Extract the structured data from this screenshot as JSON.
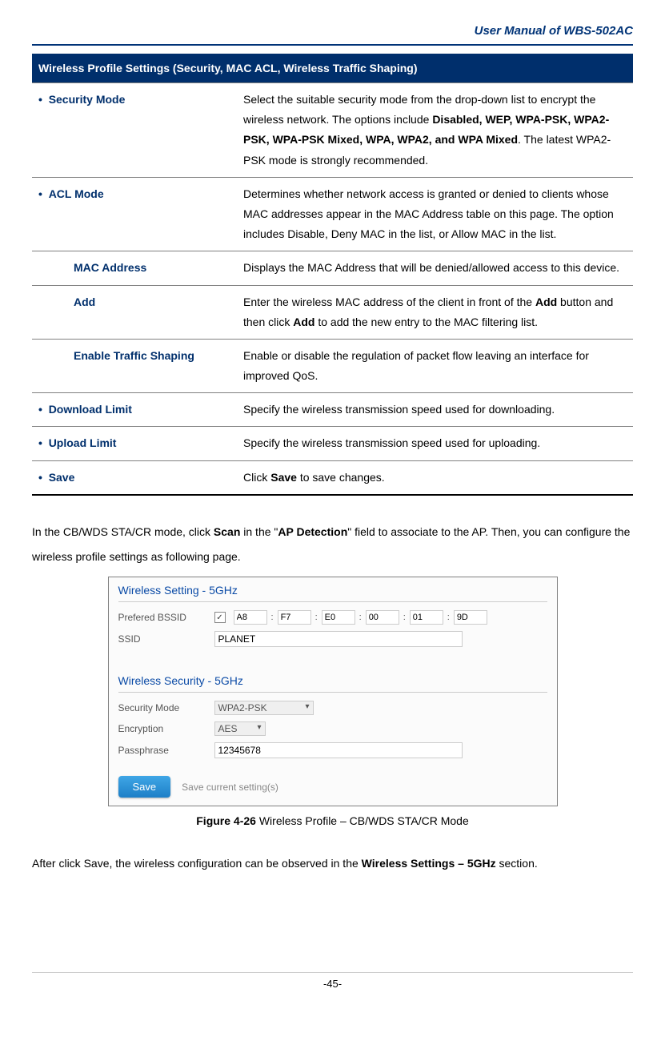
{
  "header": {
    "title": "User  Manual  of  WBS-502AC"
  },
  "table": {
    "heading": "Wireless Profile Settings (Security, MAC ACL, Wireless Traffic Shaping)",
    "rows": [
      {
        "bullet": true,
        "term": "Security Mode",
        "desc_html": "Select the suitable security mode from the drop-down list to encrypt the wireless network. The options include <b class='inner'>Disabled, WEP, WPA-PSK, WPA2-PSK, WPA-PSK Mixed, WPA, WPA2, and WPA Mixed</b>. The latest WPA2-PSK mode is strongly recommended."
      },
      {
        "bullet": true,
        "term": "ACL Mode",
        "desc_html": "Determines whether network access is granted or denied to clients whose MAC addresses appear in the MAC Address table on this page. The option includes Disable, Deny MAC in the list, or Allow MAC in the list."
      },
      {
        "bullet": false,
        "indent": true,
        "term": "MAC Address",
        "desc_html": "Displays the MAC Address that will be denied/allowed access to this device."
      },
      {
        "bullet": false,
        "indent": true,
        "term": "Add",
        "desc_html": "Enter the wireless MAC address of the client in front of the <b class='inner'>Add</b> button and then click <b class='inner'>Add</b> to add the new entry to the MAC filtering list."
      },
      {
        "bullet": false,
        "indent": true,
        "term": "Enable Traffic Shaping",
        "desc_html": "Enable or disable the regulation of packet flow leaving an interface for improved QoS."
      },
      {
        "bullet": true,
        "term": "Download Limit",
        "desc_html": "Specify the wireless transmission speed used for downloading."
      },
      {
        "bullet": true,
        "term": "Upload Limit",
        "desc_html": "Specify the wireless transmission speed used for uploading."
      },
      {
        "bullet": true,
        "term": "Save",
        "desc_html": "Click <b class='inner'>Save</b> to save changes."
      }
    ]
  },
  "para1_html": "In the CB/WDS STA/CR mode, click <b class='inner'>Scan</b> in the \"<b class='inner'>AP Detection</b>\" field to associate to the AP. Then, you can configure the wireless profile settings as following page.",
  "screenshot": {
    "section1_title": "Wireless Setting - 5GHz",
    "bssid": {
      "label": "Prefered BSSID",
      "checked": true,
      "values": [
        "A8",
        "F7",
        "E0",
        "00",
        "01",
        "9D"
      ]
    },
    "ssid": {
      "label": "SSID",
      "value": "PLANET"
    },
    "section2_title": "Wireless Security - 5GHz",
    "security": {
      "label": "Security Mode",
      "value": "WPA2-PSK"
    },
    "encryption": {
      "label": "Encryption",
      "value": "AES"
    },
    "pass": {
      "label": "Passphrase",
      "value": "12345678"
    },
    "save_btn": "Save",
    "save_hint": "Save current setting(s)"
  },
  "figcap_html": "<b class='inner'>Figure 4-26</b> Wireless Profile – CB/WDS STA/CR Mode",
  "para2_html": "After click Save, the wireless configuration can be observed in the <b class='inner'>Wireless Settings – 5GHz</b> section.",
  "footer": "-45-"
}
